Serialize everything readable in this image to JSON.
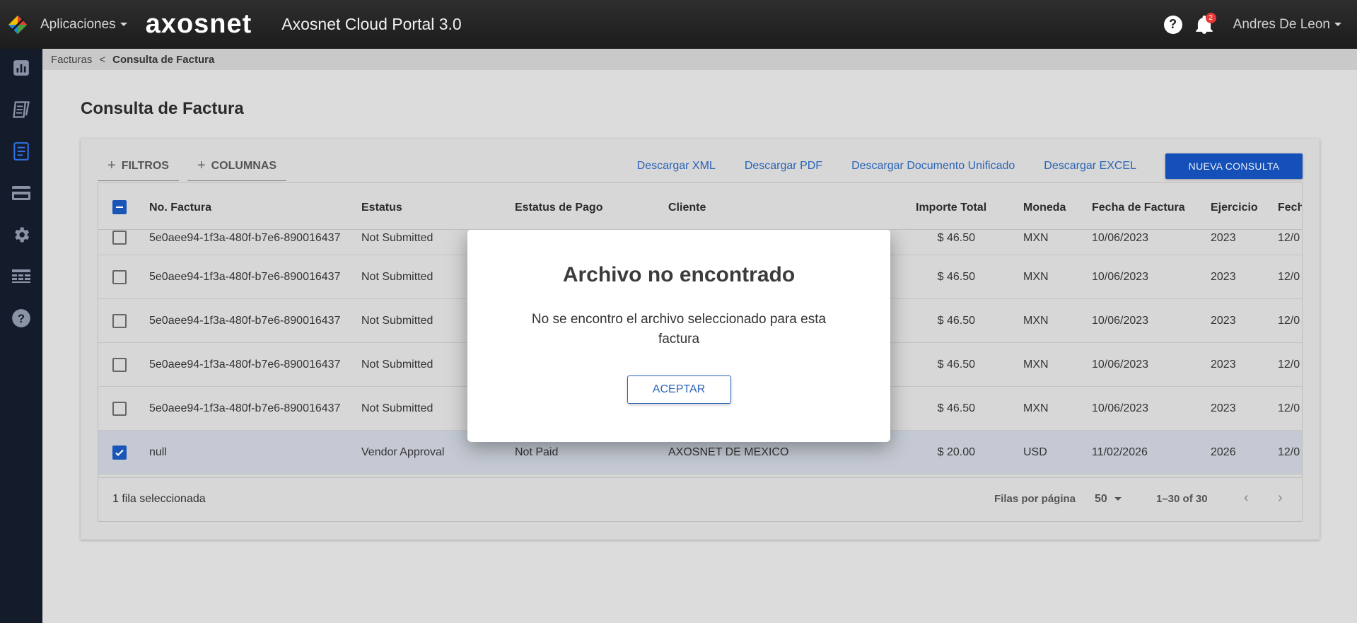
{
  "header": {
    "apps_label": "Aplicaciones",
    "brand": "axosnet",
    "portal_title": "Axosnet Cloud Portal 3.0",
    "notification_count": "2",
    "user_name": "Andres De Leon"
  },
  "sidebar": {
    "items": [
      {
        "icon": "bar-chart-icon"
      },
      {
        "icon": "documents-icon"
      },
      {
        "icon": "invoice-icon",
        "active": true
      },
      {
        "icon": "credit-card-icon"
      },
      {
        "icon": "gear-icon"
      },
      {
        "icon": "table-icon"
      },
      {
        "icon": "help-icon"
      }
    ]
  },
  "breadcrumb": {
    "parent": "Facturas",
    "separator": "<",
    "current": "Consulta de Factura"
  },
  "page_title": "Consulta de Factura",
  "toolbar": {
    "filters": "FILTROS",
    "columns": "COLUMNAS",
    "download_xml": "Descargar XML",
    "download_pdf": "Descargar PDF",
    "download_unified": "Descargar Documento Unificado",
    "download_excel": "Descargar EXCEL",
    "new_query": "NUEVA CONSULTA"
  },
  "table": {
    "headers": {
      "invoice_no": "No. Factura",
      "status": "Estatus",
      "payment_status": "Estatus de Pago",
      "client": "Cliente",
      "total": "Importe Total",
      "currency": "Moneda",
      "invoice_date": "Fecha de Factura",
      "fiscal_year": "Ejercicio",
      "date2": "Fech"
    },
    "rows": [
      {
        "invoice_no": "5e0aee94-1f3a-480f-b7e6-890016437",
        "status": "Not Submitted",
        "payment_status": "",
        "client": "",
        "total": "$ 46.50",
        "currency": "MXN",
        "invoice_date": "10/06/2023",
        "fiscal_year": "2023",
        "date2": "12/0"
      },
      {
        "invoice_no": "5e0aee94-1f3a-480f-b7e6-890016437",
        "status": "Not Submitted",
        "payment_status": "",
        "client": "",
        "total": "$ 46.50",
        "currency": "MXN",
        "invoice_date": "10/06/2023",
        "fiscal_year": "2023",
        "date2": "12/0"
      },
      {
        "invoice_no": "5e0aee94-1f3a-480f-b7e6-890016437",
        "status": "Not Submitted",
        "payment_status": "",
        "client": "",
        "total": "$ 46.50",
        "currency": "MXN",
        "invoice_date": "10/06/2023",
        "fiscal_year": "2023",
        "date2": "12/0"
      },
      {
        "invoice_no": "5e0aee94-1f3a-480f-b7e6-890016437",
        "status": "Not Submitted",
        "payment_status": "",
        "client": "",
        "total": "$ 46.50",
        "currency": "MXN",
        "invoice_date": "10/06/2023",
        "fiscal_year": "2023",
        "date2": "12/0"
      },
      {
        "invoice_no": "5e0aee94-1f3a-480f-b7e6-890016437",
        "status": "Not Submitted",
        "payment_status": "",
        "client": "",
        "total": "$ 46.50",
        "currency": "MXN",
        "invoice_date": "10/06/2023",
        "fiscal_year": "2023",
        "date2": "12/0"
      },
      {
        "invoice_no": "null",
        "status": "Vendor Approval",
        "payment_status": "Not Paid",
        "client": "AXOSNET DE MEXICO",
        "total": "$ 20.00",
        "currency": "USD",
        "invoice_date": "11/02/2026",
        "fiscal_year": "2026",
        "date2": "12/0",
        "selected": true
      }
    ],
    "footer": {
      "selected_text": "1 fila seleccionada",
      "rows_per_page_label": "Filas por página",
      "rows_per_page": "50",
      "range": "1–30 of 30"
    }
  },
  "dialog": {
    "title": "Archivo no encontrado",
    "message": "No se encontro el archivo seleccionado para esta factura",
    "accept": "ACEPTAR"
  }
}
